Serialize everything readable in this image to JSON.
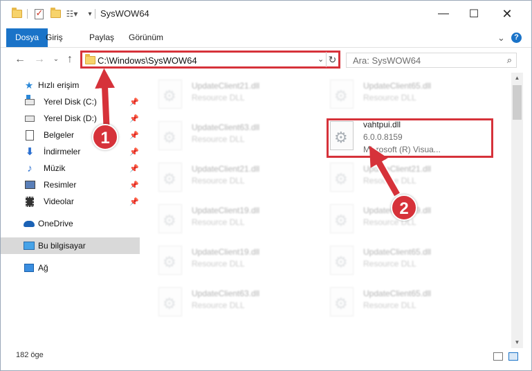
{
  "window": {
    "title": "SysWOW64"
  },
  "ribbon": {
    "tabs": [
      "Dosya",
      "Giriş",
      "Paylaş",
      "Görünüm"
    ],
    "help_glyph": "?"
  },
  "address": {
    "path": "C:\\Windows\\SysWOW64",
    "search_placeholder": "Ara: SysWOW64"
  },
  "nav": {
    "quick_access": "Hızlı erişim",
    "items": [
      {
        "label": "Yerel Disk (C:)",
        "icon": "drive-icon",
        "pinned": true
      },
      {
        "label": "Yerel Disk (D:)",
        "icon": "drive-icon",
        "pinned": true
      },
      {
        "label": "Belgeler",
        "icon": "documents-icon",
        "pinned": true
      },
      {
        "label": "İndirmeler",
        "icon": "downloads-icon",
        "pinned": true
      },
      {
        "label": "Müzik",
        "icon": "music-icon",
        "pinned": true
      },
      {
        "label": "Resimler",
        "icon": "pictures-icon",
        "pinned": true
      },
      {
        "label": "Videolar",
        "icon": "videos-icon",
        "pinned": true
      }
    ],
    "onedrive": "OneDrive",
    "this_pc": "Bu bilgisayar",
    "network": "Ağ"
  },
  "files": {
    "left": [
      {
        "name": "UpdateClient21.dll",
        "type": "Resource DLL"
      },
      {
        "name": "UpdateClient63.dll",
        "type": "Resource DLL"
      },
      {
        "name": "UpdateClient21.dll",
        "type": "Resource DLL"
      },
      {
        "name": "UpdateClient19.dll",
        "type": "Resource DLL"
      },
      {
        "name": "UpdateClient19.dll",
        "type": "Resource DLL"
      },
      {
        "name": "UpdateClient63.dll",
        "type": "Resource DLL"
      }
    ],
    "right": [
      {
        "name": "UpdateClient65.dll",
        "type": "Resource DLL"
      },
      {
        "name": "UpdateClient21.dll",
        "type": "Resource DLL"
      },
      {
        "name": "UpdateClient19.dll",
        "type": "Resource DLL"
      },
      {
        "name": "UpdateClient65.dll",
        "type": "Resource DLL"
      },
      {
        "name": "UpdateClient65.dll",
        "type": "Resource DLL"
      }
    ],
    "highlighted": {
      "name": "vahtpui.dll",
      "version": "6.0.0.8159",
      "description": "Microsoft (R) Visua..."
    }
  },
  "status": {
    "count": "182 öge"
  },
  "annotations": {
    "step1": "1",
    "step2": "2",
    "color": "#d6323a"
  },
  "colors": {
    "accent": "#1a73c8",
    "highlight": "#d6323a"
  }
}
